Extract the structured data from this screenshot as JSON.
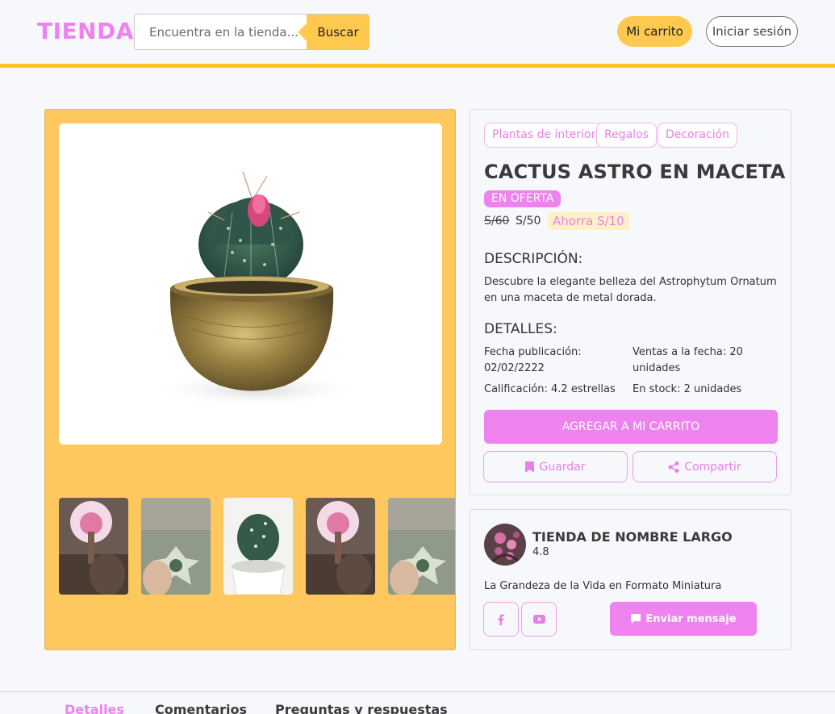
{
  "header": {
    "logo": "TIENDA",
    "search_placeholder": "Encuentra en la tienda...",
    "search_button": "Buscar",
    "cart_button": "Mi carrito",
    "login_button": "Iniciar sesión"
  },
  "gallery": {
    "thumbnail_count": 5
  },
  "product": {
    "tags": [
      "Plantas de interior",
      "Regalos",
      "Decoración"
    ],
    "title": "CACTUS ASTRO EN MACETA",
    "offer_badge": "EN OFERTA",
    "old_price": "S/60",
    "price": "S/50",
    "savings": "Ahorra S/10",
    "description_heading": "DESCRIPCIÓN:",
    "description": "Descubre la elegante belleza del Astrophytum Ornatum en una maceta de metal dorada.",
    "details_heading": "DETALLES:",
    "details": {
      "publication": "Fecha publicación: 02/02/2222",
      "sales": "Ventas a la fecha: 20 unidades",
      "rating": "Calificación: 4.2 estrellas",
      "stock": "En stock: 2 unidades"
    },
    "add_to_cart": "AGREGAR A MI CARRITO",
    "save_button": "Guardar",
    "share_button": "Compartir"
  },
  "store": {
    "name": "TIENDA DE NOMBRE LARGO",
    "rating": "4.8",
    "tagline": "La Grandeza de la Vida en Formato Miniatura",
    "message_button": "Enviar mensaje"
  },
  "tabs": [
    "Detalles",
    "Comentarios",
    "Preguntas y respuestas"
  ],
  "colors": {
    "accent_pink": "#ee82ee",
    "accent_yellow": "#ffc94f",
    "header_rule": "#f7c51e"
  }
}
